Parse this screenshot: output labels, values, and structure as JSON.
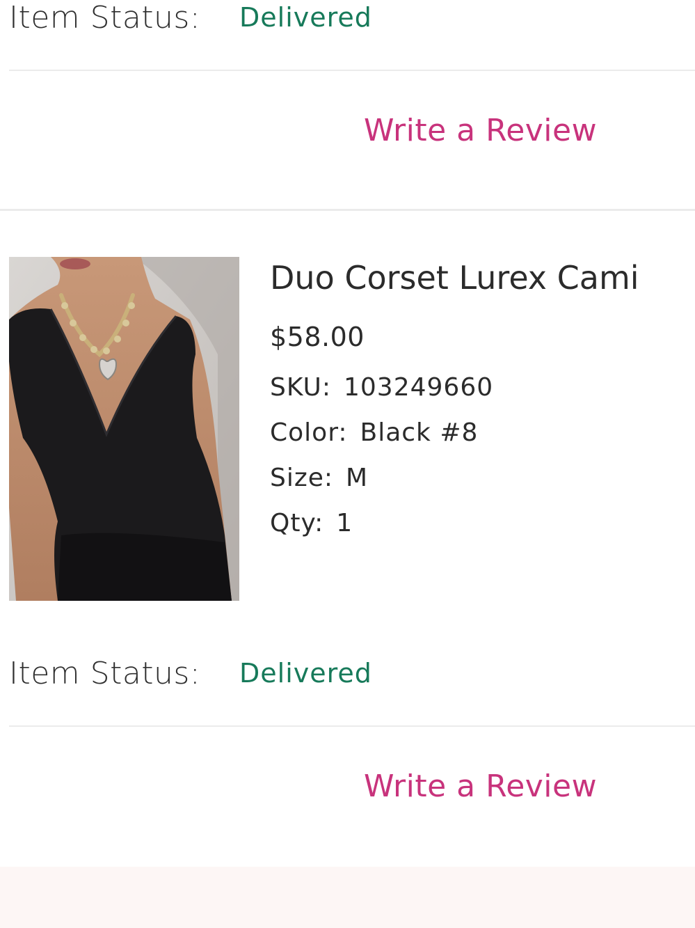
{
  "order_items": [
    {
      "status_label": "Item Status:",
      "status_value": "Delivered",
      "review_label": "Write a Review"
    },
    {
      "product_name": "Duo Corset Lurex Cami",
      "price": "$58.00",
      "sku_label": "SKU:",
      "sku_value": "103249660",
      "color_label": "Color:",
      "color_value": "Black #8",
      "size_label": "Size:",
      "size_value": "M",
      "qty_label": "Qty:",
      "qty_value": "1",
      "status_label": "Item Status:",
      "status_value": "Delivered",
      "review_label": "Write a Review"
    }
  ],
  "colors": {
    "status_green": "#177a5a",
    "review_pink": "#c8337c",
    "text_dark": "#2b2b2b",
    "divider": "#ebebeb",
    "footer_bg": "#fdf6f5"
  }
}
